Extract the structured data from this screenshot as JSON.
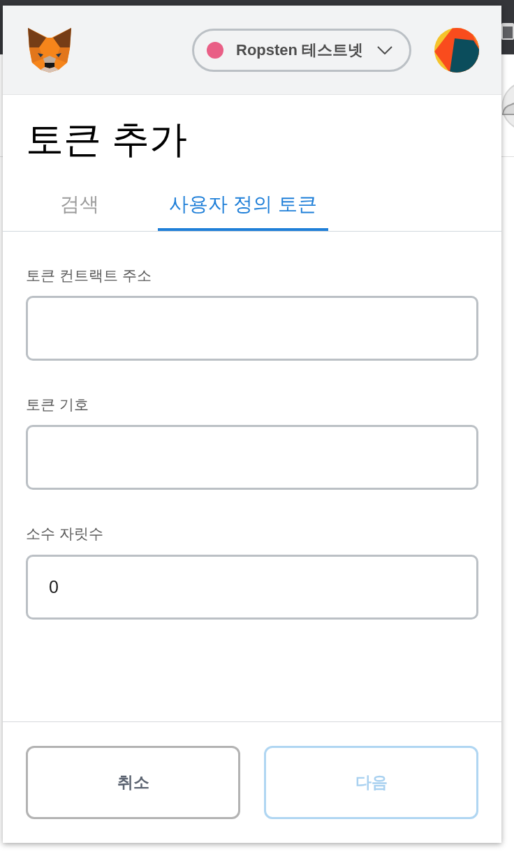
{
  "header": {
    "network": {
      "name": "Ropsten 테스트넷",
      "color": "#e95f86"
    }
  },
  "title": "토큰 추가",
  "tabs": [
    {
      "label": "검색",
      "selected": false
    },
    {
      "label": "사용자 정의 토큰",
      "selected": true
    }
  ],
  "fields": [
    {
      "label": "토큰 컨트랙트 주소"
    },
    {
      "label": "토큰 기호"
    },
    {
      "label": "소수 자릿수",
      "value": "0"
    }
  ],
  "buttons": [
    {
      "label": "취소",
      "kind": "cancel",
      "disabled": false
    },
    {
      "label": "다음",
      "kind": "next",
      "disabled": true
    }
  ]
}
